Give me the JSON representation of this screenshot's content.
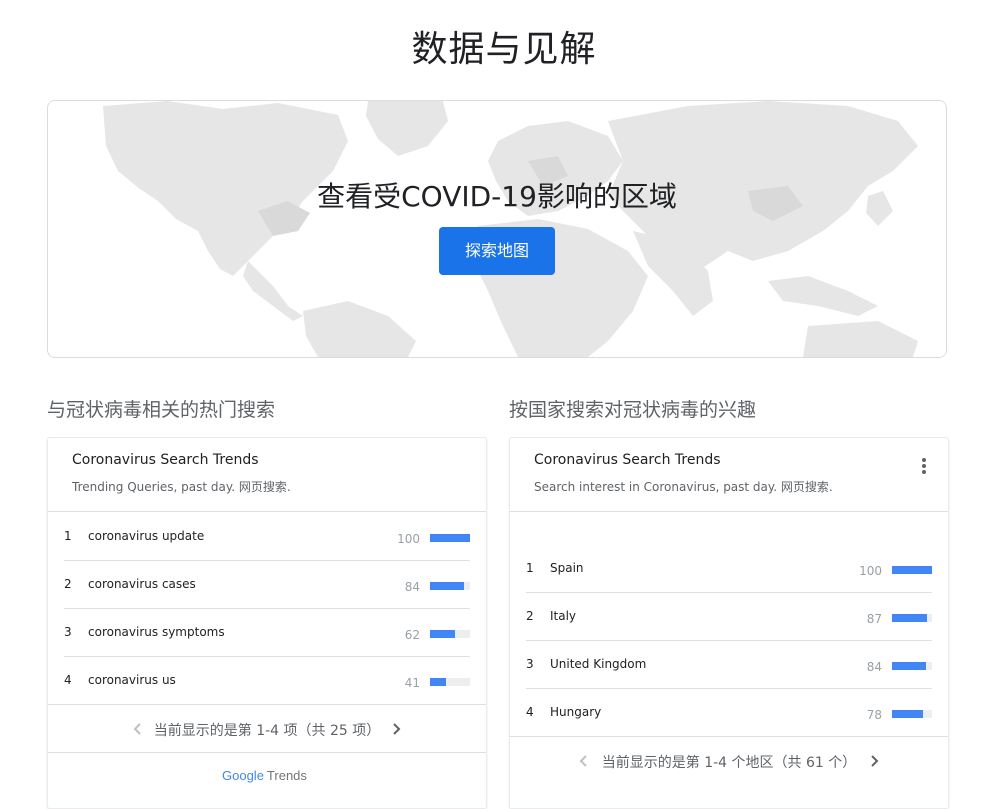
{
  "page": {
    "title": "数据与见解"
  },
  "map_card": {
    "headline": "查看受COVID-19影响的区域",
    "button_label": "探索地图"
  },
  "left_section": {
    "heading": "与冠状病毒相关的热门搜索",
    "widget": {
      "title": "Coronavirus Search Trends",
      "subtitle": "Trending Queries, past day. 网页搜索.",
      "rows": [
        {
          "rank": "1",
          "label": "coronavirus update",
          "value": "100",
          "fraction": 1.0
        },
        {
          "rank": "2",
          "label": "coronavirus cases",
          "value": "84",
          "fraction": 0.84
        },
        {
          "rank": "3",
          "label": "coronavirus symptoms",
          "value": "62",
          "fraction": 0.62
        },
        {
          "rank": "4",
          "label": "coronavirus us",
          "value": "41",
          "fraction": 0.41
        }
      ],
      "pager_text": "当前显示的是第 1-4 项（共 25 项）",
      "footer_brand": "Google",
      "footer_product": "Trends"
    }
  },
  "right_section": {
    "heading": "按国家搜索对冠状病毒的兴趣",
    "widget": {
      "title": "Coronavirus Search Trends",
      "subtitle": "Search interest in Coronavirus, past day. 网页搜索.",
      "rows": [
        {
          "rank": "1",
          "label": "Spain",
          "value": "100",
          "fraction": 1.0
        },
        {
          "rank": "2",
          "label": "Italy",
          "value": "87",
          "fraction": 0.87
        },
        {
          "rank": "3",
          "label": "United Kingdom",
          "value": "84",
          "fraction": 0.84
        },
        {
          "rank": "4",
          "label": "Hungary",
          "value": "78",
          "fraction": 0.78
        }
      ],
      "pager_text": "当前显示的是第 1-4 个地区（共 61 个）"
    }
  },
  "colors": {
    "accent": "#1a73e8",
    "bar": "#4285f4",
    "bar_track": "#eeeeee",
    "map_land": "#e3e3e3"
  },
  "icons": [
    "more-vert-icon",
    "chevron-left-icon",
    "chevron-right-icon"
  ]
}
